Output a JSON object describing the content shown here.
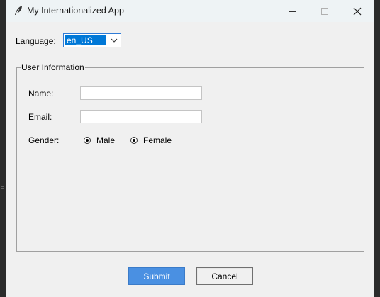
{
  "window": {
    "title": "My Internationalized App",
    "icon": "feather-icon"
  },
  "language": {
    "label": "Language:",
    "selected": "en_US"
  },
  "user_info": {
    "title": "User Information",
    "name_label": "Name:",
    "name_value": "",
    "email_label": "Email:",
    "email_value": "",
    "gender_label": "Gender:",
    "options": [
      "Male",
      "Female"
    ]
  },
  "buttons": {
    "submit": "Submit",
    "cancel": "Cancel"
  },
  "colors": {
    "accent": "#4a90e2",
    "selection": "#0078d7",
    "background": "#f0f0f0"
  }
}
